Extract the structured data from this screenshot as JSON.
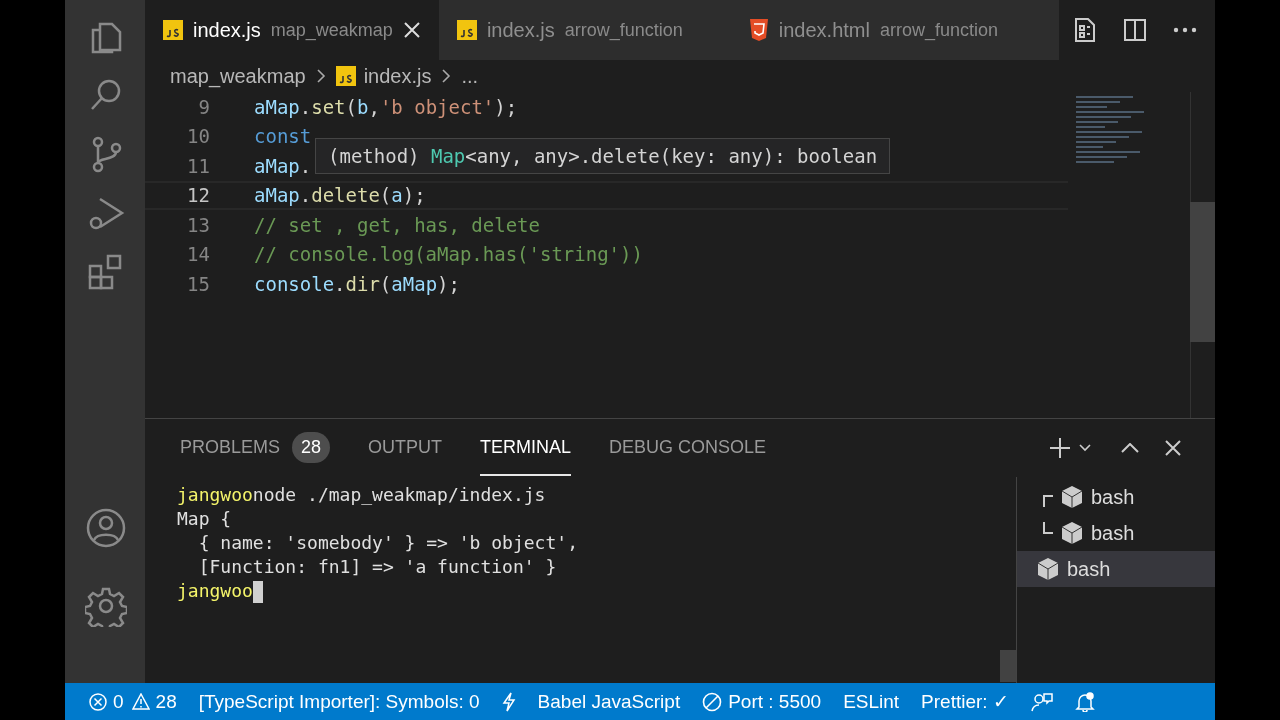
{
  "activity_bar": {
    "items": [
      {
        "kind": "files",
        "selected": false
      },
      {
        "kind": "search",
        "selected": false
      },
      {
        "kind": "source-control",
        "selected": false
      },
      {
        "kind": "run",
        "selected": false
      },
      {
        "kind": "extensions",
        "selected": false
      }
    ],
    "bottom": [
      {
        "kind": "account"
      },
      {
        "kind": "settings"
      }
    ]
  },
  "tabs": [
    {
      "kind": "js",
      "label": "index.js",
      "description": "map_weakmap",
      "selected": true
    },
    {
      "kind": "js",
      "label": "index.js",
      "description": "arrow_function",
      "selected": false
    },
    {
      "kind": "html",
      "label": "index.html",
      "description": "arrow_function",
      "selected": false
    }
  ],
  "breadcrumb": {
    "folder": "map_weakmap",
    "file": "index.js",
    "more": "..."
  },
  "editor": {
    "lines": [
      {
        "number": "9",
        "current": false,
        "tokens": [
          {
            "text": "aMap",
            "kind": "var"
          },
          {
            "text": ".",
            "kind": "plain"
          },
          {
            "text": "set",
            "kind": "fn"
          },
          {
            "text": "(",
            "kind": "plain"
          },
          {
            "text": "b",
            "kind": "var"
          },
          {
            "text": ",",
            "kind": "plain"
          },
          {
            "text": "'b object'",
            "kind": "string"
          },
          {
            "text": ");",
            "kind": "plain"
          }
        ]
      },
      {
        "number": "10",
        "current": false,
        "tokens": [
          {
            "text": "const",
            "kind": "keyword"
          }
        ]
      },
      {
        "number": "11",
        "current": false,
        "tokens": [
          {
            "text": "aMap",
            "kind": "var"
          },
          {
            "text": ".",
            "kind": "plain"
          }
        ]
      },
      {
        "number": "12",
        "current": true,
        "tokens": [
          {
            "text": "aMap",
            "kind": "var"
          },
          {
            "text": ".",
            "kind": "plain"
          },
          {
            "text": "delete",
            "kind": "fn"
          },
          {
            "text": "(",
            "kind": "plain"
          },
          {
            "text": "a",
            "kind": "var"
          },
          {
            "text": ");",
            "kind": "plain"
          }
        ]
      },
      {
        "number": "13",
        "current": false,
        "tokens": [
          {
            "text": "// set , get, has, delete",
            "kind": "comment"
          }
        ]
      },
      {
        "number": "14",
        "current": false,
        "tokens": [
          {
            "text": "// console.log(aMap.has('string'))",
            "kind": "comment"
          }
        ]
      },
      {
        "number": "15",
        "current": false,
        "tokens": [
          {
            "text": "console",
            "kind": "var"
          },
          {
            "text": ".",
            "kind": "plain"
          },
          {
            "text": "dir",
            "kind": "fn"
          },
          {
            "text": "(",
            "kind": "plain"
          },
          {
            "text": "aMap",
            "kind": "var"
          },
          {
            "text": ");",
            "kind": "plain"
          }
        ]
      }
    ],
    "hover": {
      "tokens": [
        {
          "text": "(method) ",
          "kind": "plain"
        },
        {
          "text": "Map",
          "kind": "type"
        },
        {
          "text": "<any, any>.delete(key: any): boolean",
          "kind": "plain"
        }
      ]
    }
  },
  "panel": {
    "tabs": [
      {
        "label": "PROBLEMS",
        "badge": "28",
        "selected": false
      },
      {
        "label": "OUTPUT",
        "selected": false
      },
      {
        "label": "TERMINAL",
        "selected": true
      },
      {
        "label": "DEBUG CONSOLE",
        "selected": false
      }
    ],
    "terminal_lines": [
      {
        "prompt": "jangwoo",
        "text": "node ./map_weakmap/index.js"
      },
      {
        "text": "Map {"
      },
      {
        "text": "  { name: 'somebody' } => 'b object',"
      },
      {
        "text": "  [Function: fn1] => 'a function' }"
      },
      {
        "prompt": "jangwoo",
        "cursor": true
      }
    ],
    "terminals": [
      {
        "kind": "group",
        "children": [
          {
            "label": "bash",
            "selected": false
          },
          {
            "label": "bash",
            "selected": false
          }
        ]
      },
      {
        "kind": "single",
        "label": "bash",
        "selected": true
      }
    ]
  },
  "status_bar": {
    "items": [
      {
        "kind": "problems",
        "errors": "0",
        "warnings": "28"
      },
      {
        "kind": "text",
        "text": "[TypeScript Importer]: Symbols: 0"
      },
      {
        "kind": "bolt"
      },
      {
        "kind": "text",
        "text": "Babel JavaScript"
      },
      {
        "kind": "port",
        "text": "Port : 5500"
      },
      {
        "kind": "text",
        "text": "ESLint"
      },
      {
        "kind": "text",
        "text": "Prettier: ✓"
      },
      {
        "kind": "feedback"
      },
      {
        "kind": "bell"
      }
    ]
  }
}
